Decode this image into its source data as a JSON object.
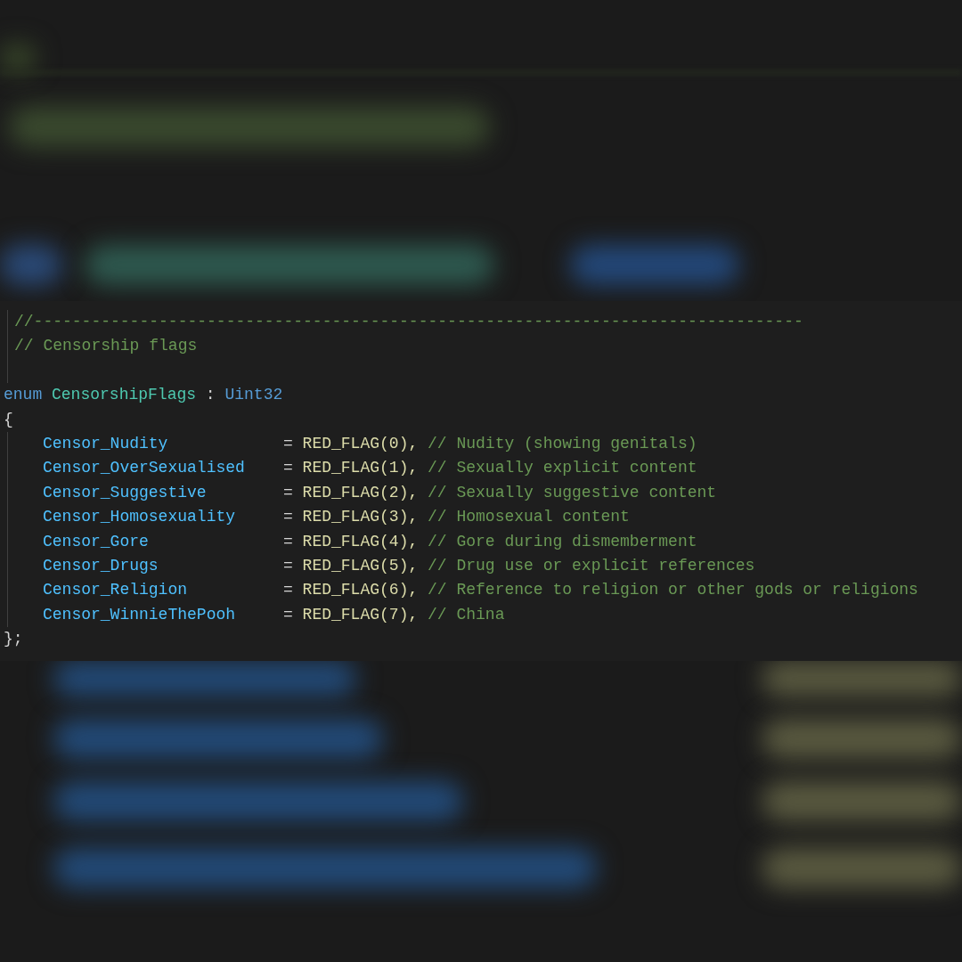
{
  "editor": {
    "comment_lines": [
      "//--------------------------------------------------------------------------------",
      "// Censorship flags"
    ],
    "enum_declaration": {
      "keyword": "enum",
      "name": "CensorshipFlags",
      "separator": ":",
      "type": "Uint32"
    },
    "open_brace": "{",
    "entries": [
      {
        "name": "Censor_Nudity",
        "operator": "=",
        "value": "RED_FLAG(0),",
        "comment": "// Nudity (showing genitals)"
      },
      {
        "name": "Censor_OverSexualised",
        "operator": "=",
        "value": "RED_FLAG(1),",
        "comment": "// Sexually explicit content"
      },
      {
        "name": "Censor_Suggestive",
        "operator": "=",
        "value": "RED_FLAG(2),",
        "comment": "// Sexually suggestive content"
      },
      {
        "name": "Censor_Homosexuality",
        "operator": "=",
        "value": "RED_FLAG(3),",
        "comment": "// Homosexual content"
      },
      {
        "name": "Censor_Gore",
        "operator": "=",
        "value": "RED_FLAG(4),",
        "comment": "// Gore during dismemberment"
      },
      {
        "name": "Censor_Drugs",
        "operator": "=",
        "value": "RED_FLAG(5),",
        "comment": "// Drug use or explicit references"
      },
      {
        "name": "Censor_Religion",
        "operator": "=",
        "value": "RED_FLAG(6),",
        "comment": "// Reference to religion or other gods or religions"
      },
      {
        "name": "Censor_WinnieThePooh",
        "operator": "=",
        "value": "RED_FLAG(7),",
        "comment": "// China"
      }
    ],
    "close_brace": "};"
  }
}
